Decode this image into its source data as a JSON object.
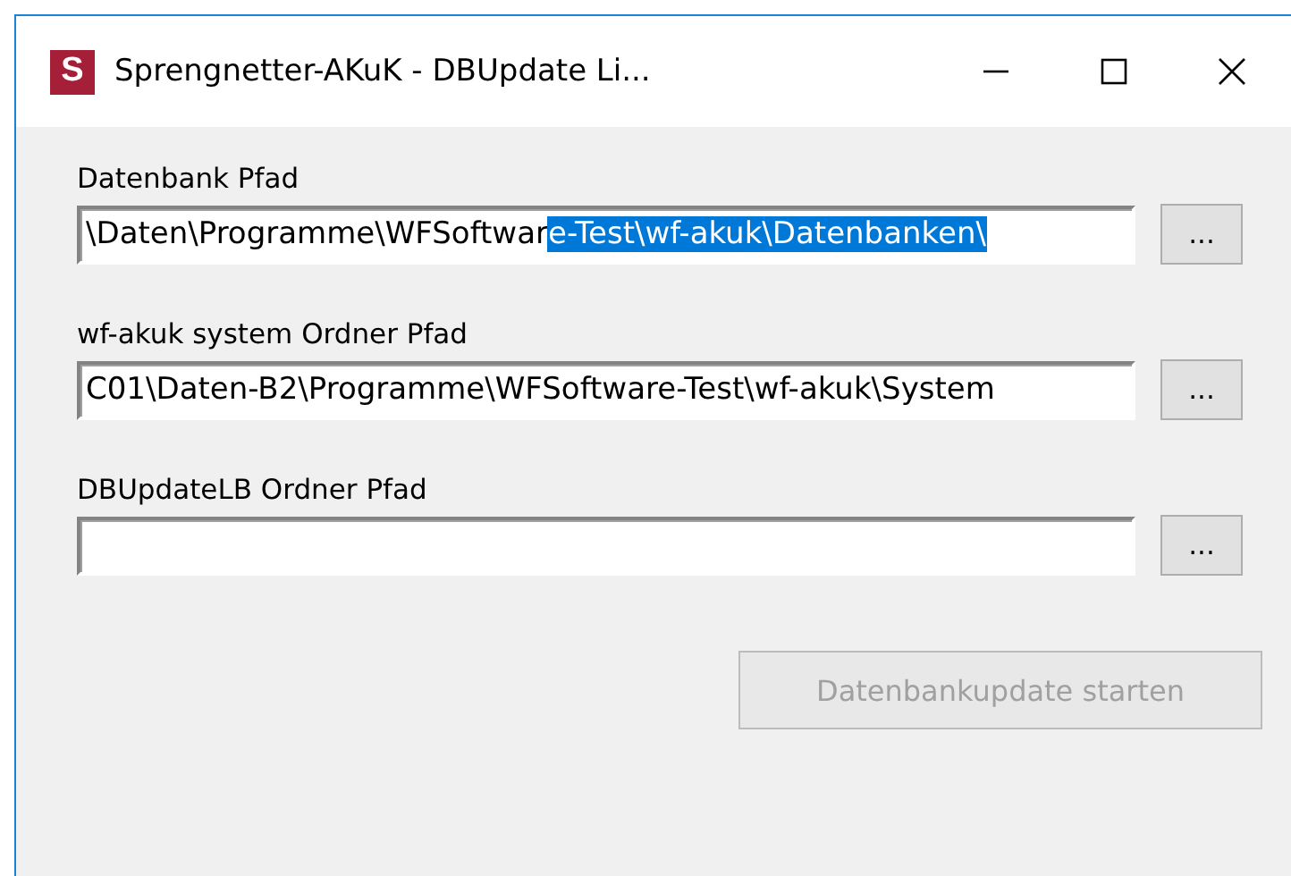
{
  "window": {
    "title": "Sprengnetter-AKuK - DBUpdate Li...",
    "app_icon": "S"
  },
  "fields": [
    {
      "label": "Datenbank Pfad",
      "segments": [
        {
          "text": "\\Daten\\Programme\\WFSoftwar",
          "selected": false
        },
        {
          "text": "e-Test\\wf-akuk\\Datenbanken\\",
          "selected": true
        }
      ],
      "browse": "..."
    },
    {
      "label": "wf-akuk system Ordner Pfad",
      "segments": [
        {
          "text": "C01\\Daten-B2\\Programme\\WFSoftware-Test\\wf-akuk\\System",
          "selected": false
        }
      ],
      "browse": "..."
    },
    {
      "label": "DBUpdateLB Ordner Pfad",
      "browse": "..."
    }
  ],
  "start_button": {
    "label": "Datenbankupdate starten",
    "disabled": true
  }
}
